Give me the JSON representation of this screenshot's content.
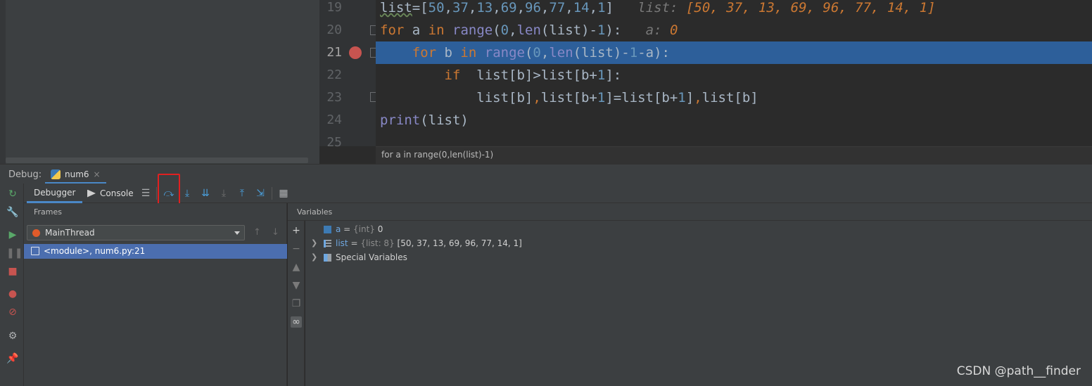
{
  "editor": {
    "lines": [
      {
        "num": "19"
      },
      {
        "num": "20"
      },
      {
        "num": "21"
      },
      {
        "num": "22"
      },
      {
        "num": "23"
      },
      {
        "num": "24"
      },
      {
        "num": "25"
      }
    ],
    "inline_hints": {
      "line19_label": "list:",
      "line19_value": "[50, 37, 13, 69, 96, 77, 14, 1]",
      "line20_label": "a:",
      "line20_value": "0"
    },
    "breadcrumb": "for a in range(0,len(list)-1)",
    "current_line": 21
  },
  "debug": {
    "title": "Debug:",
    "run_tab": "num6",
    "tabs": {
      "debugger": "Debugger",
      "console": "Console"
    },
    "frames_title": "Frames",
    "thread": "MainThread",
    "frame": "<module>, num6.py:21",
    "variables_title": "Variables",
    "variables": [
      {
        "name": "a",
        "type": "{int}",
        "value": "0"
      },
      {
        "name": "list",
        "type": "{list: 8}",
        "value": "[50, 37, 13, 69, 96, 77, 14, 1]"
      }
    ],
    "special_variables": "Special Variables"
  },
  "colors": {
    "accent": "#4a88c7",
    "selection": "#4b6eaf",
    "current_line": "#2d5f9a",
    "breakpoint": "#c75450",
    "highlight_box": "#e02020"
  },
  "watermark": "CSDN @path__finder"
}
